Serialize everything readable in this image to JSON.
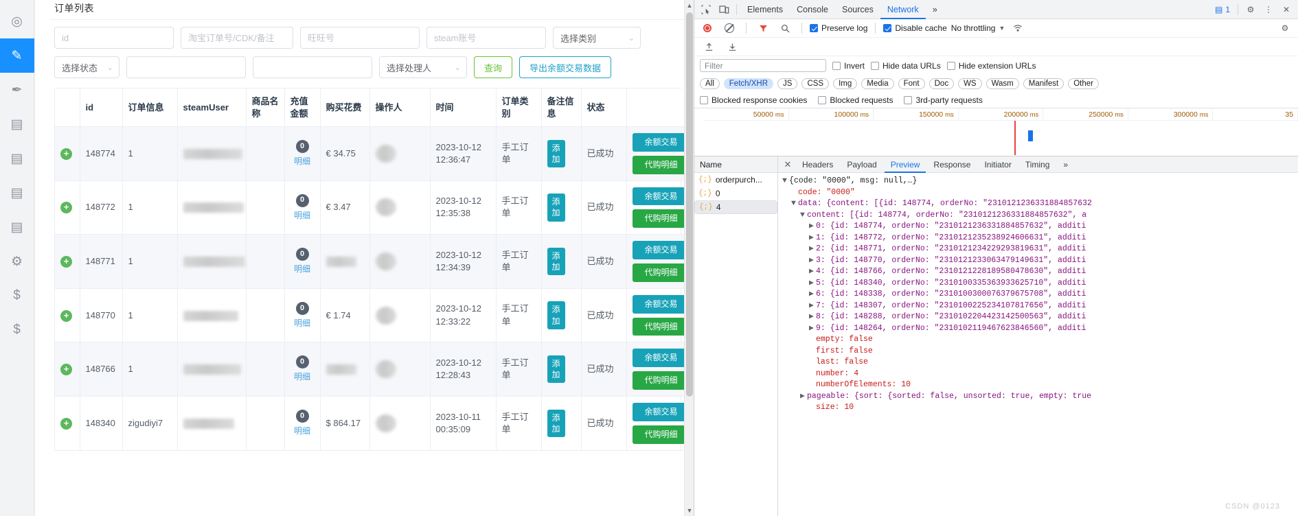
{
  "rail": {
    "items": [
      {
        "name": "dashboard-icon",
        "glyph": "◎"
      },
      {
        "name": "edit-icon",
        "glyph": "✎",
        "active": true
      },
      {
        "name": "pen-icon",
        "glyph": "✒"
      },
      {
        "name": "calendar-icon-1",
        "glyph": "▤"
      },
      {
        "name": "calendar-icon-2",
        "glyph": "▤"
      },
      {
        "name": "calendar-icon-3",
        "glyph": "▤"
      },
      {
        "name": "calendar-icon-4",
        "glyph": "▤"
      },
      {
        "name": "settings-icon",
        "glyph": "⚙"
      },
      {
        "name": "dollar-icon-1",
        "glyph": "$"
      },
      {
        "name": "dollar-icon-2",
        "glyph": "$"
      }
    ]
  },
  "card": {
    "title": "订单列表"
  },
  "filters": {
    "id_placeholder": "id",
    "order_placeholder": "淘宝订单号/CDK/备注",
    "wangwang_placeholder": "旺旺号",
    "steam_placeholder": "steam账号",
    "category_label": "选择类别",
    "status_label": "选择状态",
    "blank1": "",
    "blank2": "",
    "handler_label": "选择处理人",
    "search_button": "查询",
    "export_button": "导出余额交易数据"
  },
  "table": {
    "headers": [
      "",
      "id",
      "订单信息",
      "steamUser",
      "商品名称",
      "充值金额",
      "购买花费",
      "操作人",
      "时间",
      "订单类别",
      "备注信息",
      "状态",
      ""
    ],
    "tag_add_label": "添加",
    "detail_label": "明细",
    "action_balance": "余额交易",
    "action_purchase": "代购明细",
    "rows": [
      {
        "id": "148774",
        "info": "1",
        "user": "",
        "name": "",
        "amount": "0",
        "cost": "€ 34.75",
        "operator": "",
        "time": "2023-10-12 12:36:47",
        "type": "手工订单",
        "remark": "添加",
        "status": "已成功"
      },
      {
        "id": "148772",
        "info": "1",
        "user": "",
        "name": "",
        "amount": "0",
        "cost": "€ 3.47",
        "operator": "",
        "time": "2023-10-12 12:35:38",
        "type": "手工订单",
        "remark": "添加",
        "status": "已成功"
      },
      {
        "id": "148771",
        "info": "1",
        "user": "",
        "name": "",
        "amount": "0",
        "cost": "",
        "operator": "",
        "time": "2023-10-12 12:34:39",
        "type": "手工订单",
        "remark": "添加",
        "status": "已成功"
      },
      {
        "id": "148770",
        "info": "1",
        "user": "",
        "name": "",
        "amount": "0",
        "cost": "€ 1.74",
        "operator": "",
        "time": "2023-10-12 12:33:22",
        "type": "手工订单",
        "remark": "添加",
        "status": "已成功"
      },
      {
        "id": "148766",
        "info": "1",
        "user": "",
        "name": "",
        "amount": "0",
        "cost": "",
        "operator": "",
        "time": "2023-10-12 12:28:43",
        "type": "手工订单",
        "remark": "添加",
        "status": "已成功"
      },
      {
        "id": "148340",
        "info": "zigudiyi7",
        "user": "",
        "name": "",
        "amount": "0",
        "cost": "$ 864.17",
        "operator": "",
        "time": "2023-10-11 00:35:09",
        "type": "手工订单",
        "remark": "添加",
        "status": "已成功"
      }
    ]
  },
  "devtools": {
    "tabs": [
      {
        "label": "Elements",
        "active": false
      },
      {
        "label": "Console",
        "active": false
      },
      {
        "label": "Sources",
        "active": false
      },
      {
        "label": "Network",
        "active": true
      }
    ],
    "more_tabs_glyph": "»",
    "message_count": "1",
    "settings_icon": "⚙",
    "menu_icon": "⋮",
    "close_icon": "✕",
    "inspect_icon": "⬚",
    "device_icon": "▭",
    "record_icon": "record-button",
    "clear_icon": "clear-button",
    "filter_icon": "▼",
    "search_icon": "⌕",
    "import_icon": "⭡",
    "export_icon": "⭣",
    "preserve_log": {
      "label": "Preserve log",
      "checked": true
    },
    "disable_cache": {
      "label": "Disable cache",
      "checked": true
    },
    "throttling": "No throttling",
    "wifi_icon": "wifi-icon",
    "network_settings_icon": "⚙",
    "filter_placeholder": "Filter",
    "invert": {
      "label": "Invert",
      "checked": false
    },
    "hide_data_urls": {
      "label": "Hide data URLs",
      "checked": false
    },
    "hide_extension_urls": {
      "label": "Hide extension URLs",
      "checked": false
    },
    "resource_chips": [
      {
        "label": "All",
        "active": false
      },
      {
        "label": "Fetch/XHR",
        "active": true
      },
      {
        "label": "JS",
        "active": false
      },
      {
        "label": "CSS",
        "active": false
      },
      {
        "label": "Img",
        "active": false
      },
      {
        "label": "Media",
        "active": false
      },
      {
        "label": "Font",
        "active": false
      },
      {
        "label": "Doc",
        "active": false
      },
      {
        "label": "WS",
        "active": false
      },
      {
        "label": "Wasm",
        "active": false
      },
      {
        "label": "Manifest",
        "active": false
      },
      {
        "label": "Other",
        "active": false
      }
    ],
    "blocked_response_cookies": {
      "label": "Blocked response cookies",
      "checked": false
    },
    "blocked_requests": {
      "label": "Blocked requests",
      "checked": false
    },
    "third_party_requests": {
      "label": "3rd-party requests",
      "checked": false
    },
    "timeline_ticks": [
      "50000 ms",
      "100000 ms",
      "150000 ms",
      "200000 ms",
      "250000 ms",
      "300000 ms",
      "35"
    ],
    "names_header": "Name",
    "request_rows": [
      {
        "label": "orderpurch...",
        "selected": false
      },
      {
        "label": "0",
        "selected": false
      },
      {
        "label": "4",
        "selected": true
      }
    ],
    "detail_tabs": [
      {
        "label": "Headers",
        "active": false
      },
      {
        "label": "Payload",
        "active": false
      },
      {
        "label": "Preview",
        "active": true
      },
      {
        "label": "Response",
        "active": false
      },
      {
        "label": "Initiator",
        "active": false
      },
      {
        "label": "Timing",
        "active": false
      }
    ],
    "detail_more_glyph": "»",
    "preview_json": [
      {
        "indent": 0,
        "tri": "▼",
        "text": "{code: \"0000\", msg: null,…}",
        "cls": "k-dark"
      },
      {
        "indent": 1,
        "tri": "",
        "text": "code: \"0000\"",
        "cls": "k-red"
      },
      {
        "indent": 1,
        "tri": "▼",
        "text": "data: {content: [{id: 148774, orderNo: \"2310121236331884857632",
        "cls": "k-purple"
      },
      {
        "indent": 2,
        "tri": "▼",
        "text": "content: [{id: 148774, orderNo: \"2310121236331884857632\", a",
        "cls": "k-purple"
      },
      {
        "indent": 3,
        "tri": "▶",
        "text": "0: {id: 148774, orderNo: \"2310121236331884857632\", additi",
        "cls": "k-purple"
      },
      {
        "indent": 3,
        "tri": "▶",
        "text": "1: {id: 148772, orderNo: \"2310121235238924606631\", additi",
        "cls": "k-purple"
      },
      {
        "indent": 3,
        "tri": "▶",
        "text": "2: {id: 148771, orderNo: \"2310121234229293819631\", additi",
        "cls": "k-purple"
      },
      {
        "indent": 3,
        "tri": "▶",
        "text": "3: {id: 148770, orderNo: \"2310121233063479149631\", additi",
        "cls": "k-purple"
      },
      {
        "indent": 3,
        "tri": "▶",
        "text": "4: {id: 148766, orderNo: \"2310121228189580478630\", additi",
        "cls": "k-purple"
      },
      {
        "indent": 3,
        "tri": "▶",
        "text": "5: {id: 148340, orderNo: \"2310100335363933625710\", additi",
        "cls": "k-purple"
      },
      {
        "indent": 3,
        "tri": "▶",
        "text": "6: {id: 148338, orderNo: \"2310100300076379675708\", additi",
        "cls": "k-purple"
      },
      {
        "indent": 3,
        "tri": "▶",
        "text": "7: {id: 148307, orderNo: \"2310100225234107817656\", additi",
        "cls": "k-purple"
      },
      {
        "indent": 3,
        "tri": "▶",
        "text": "8: {id: 148288, orderNo: \"2310102204423142500563\", additi",
        "cls": "k-purple"
      },
      {
        "indent": 3,
        "tri": "▶",
        "text": "9: {id: 148264, orderNo: \"2310102119467623846560\", additi",
        "cls": "k-purple"
      },
      {
        "indent": 3,
        "tri": "",
        "text": "empty: false",
        "cls": "k-red"
      },
      {
        "indent": 3,
        "tri": "",
        "text": "first: false",
        "cls": "k-red"
      },
      {
        "indent": 3,
        "tri": "",
        "text": "last: false",
        "cls": "k-red"
      },
      {
        "indent": 3,
        "tri": "",
        "text": "number: 4",
        "cls": "k-red"
      },
      {
        "indent": 3,
        "tri": "",
        "text": "numberOfElements: 10",
        "cls": "k-red"
      },
      {
        "indent": 2,
        "tri": "▶",
        "text": "pageable: {sort: {sorted: false, unsorted: true, empty: true",
        "cls": "k-purple"
      },
      {
        "indent": 3,
        "tri": "",
        "text": "size: 10",
        "cls": "k-red"
      }
    ]
  },
  "watermark": "CSDN @0123"
}
